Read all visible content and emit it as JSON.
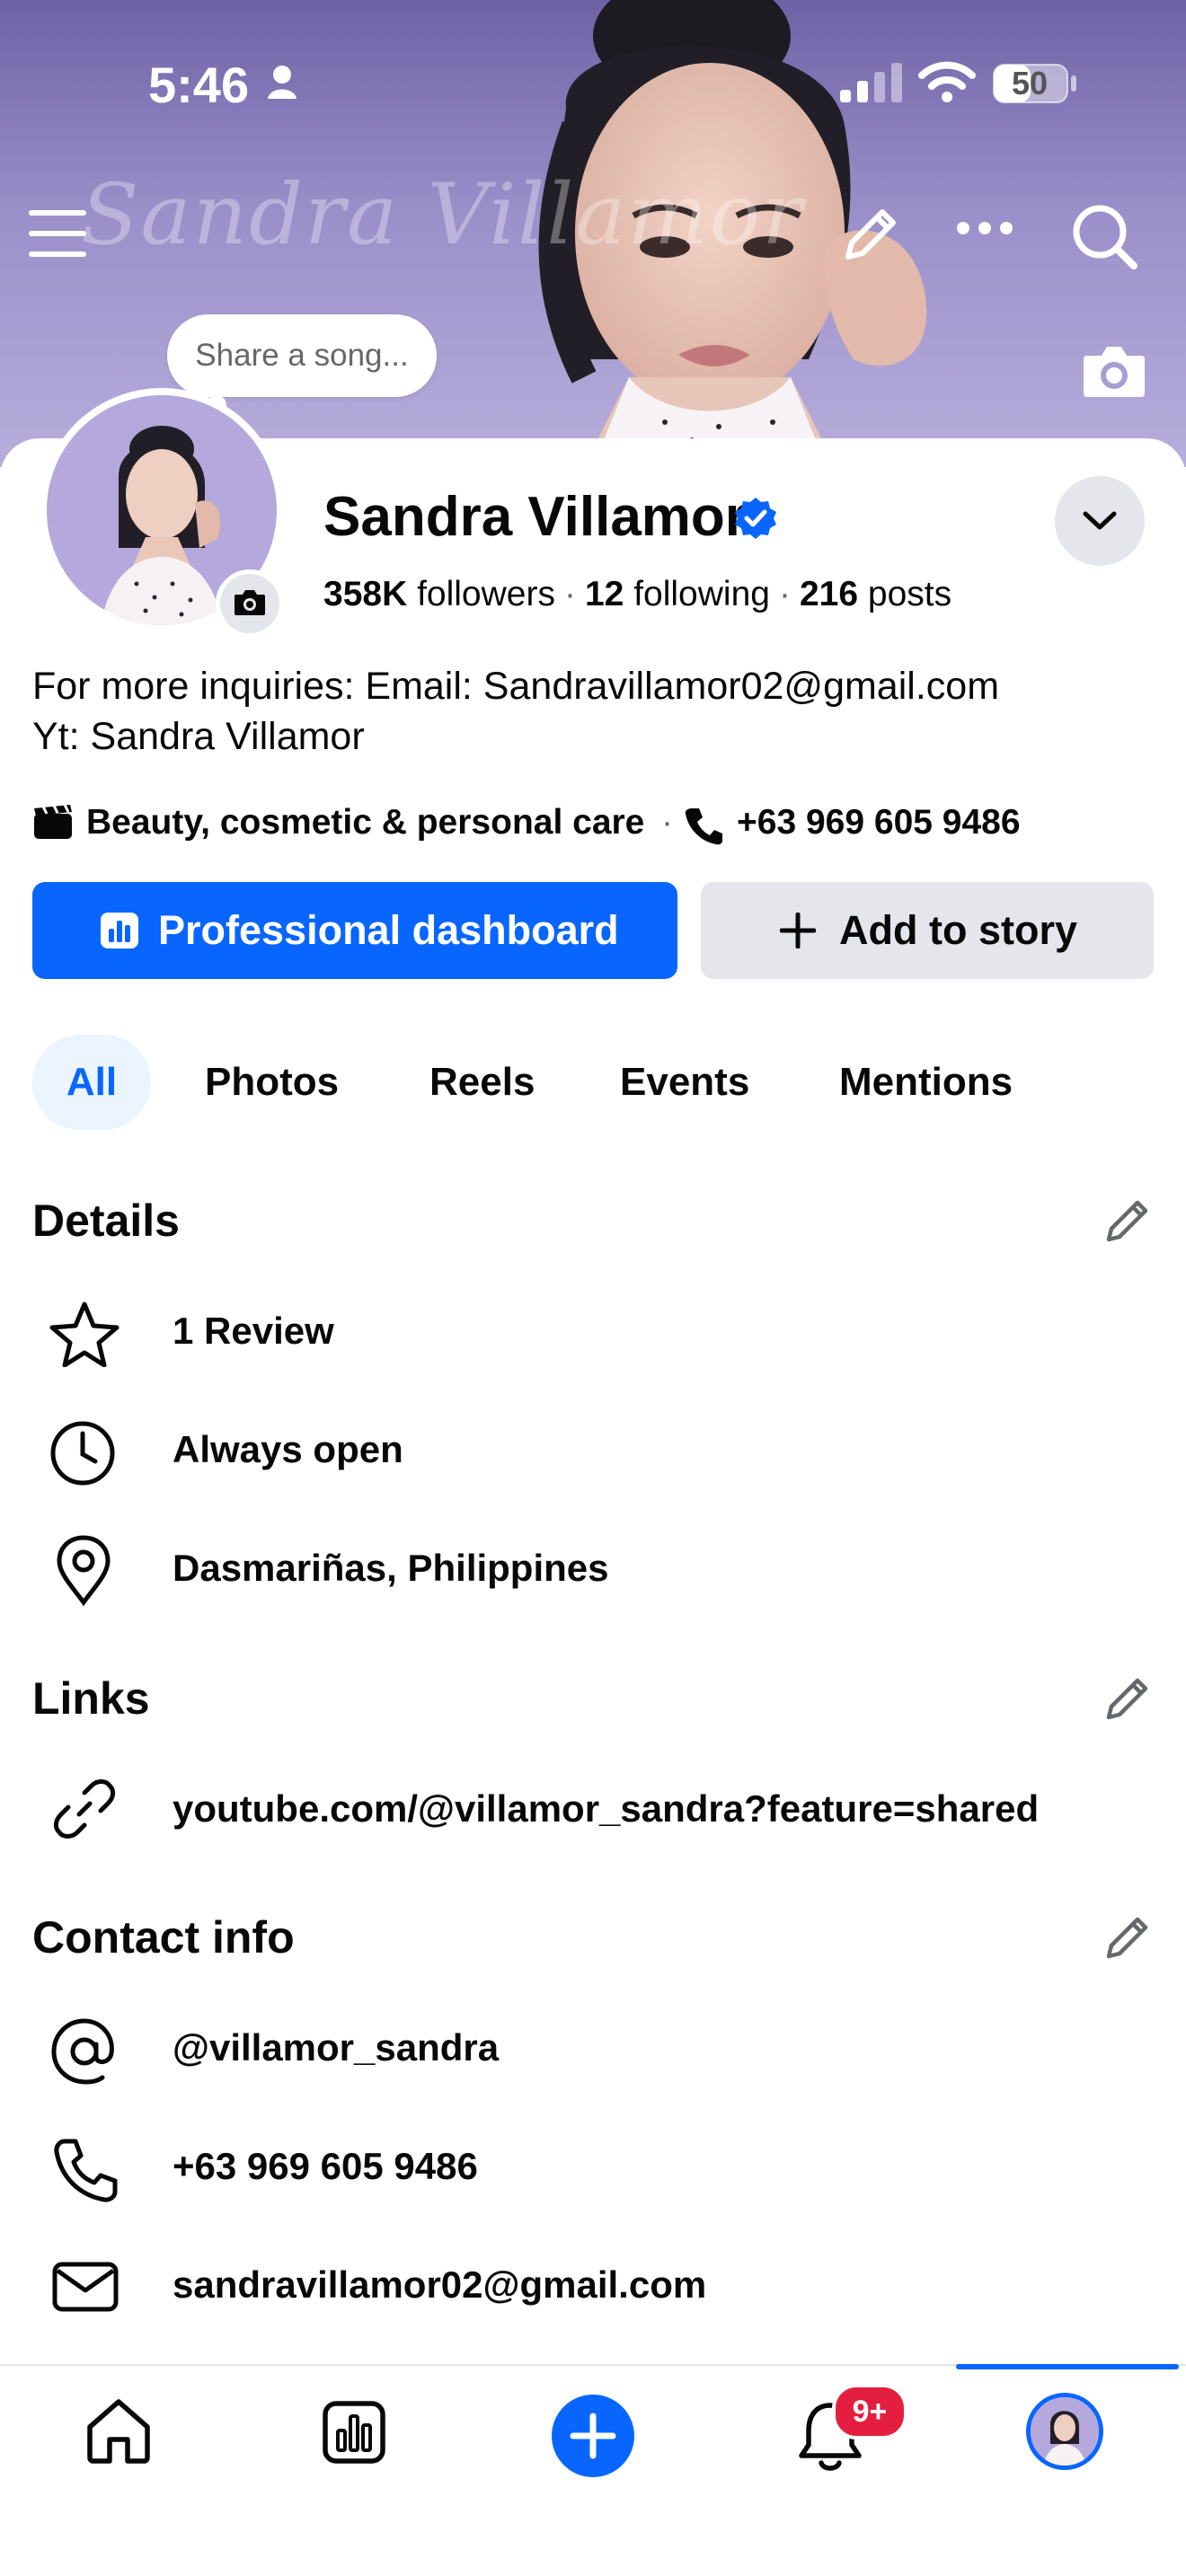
{
  "status_bar": {
    "time": "5:46",
    "battery": "50"
  },
  "cover": {
    "signature_text": "Sandra Villamor",
    "song_prompt": "Share a song..."
  },
  "profile": {
    "name": "Sandra Villamor",
    "verified": true,
    "followers_count": "358K",
    "followers_label": "followers",
    "following_count": "12",
    "following_label": "following",
    "posts_count": "216",
    "posts_label": "posts",
    "bio_line1": "For more inquiries: Email: Sandravillamor02@gmail.com",
    "bio_line2": "Yt: Sandra Villamor",
    "category": "Beauty, cosmetic & personal care",
    "category_separator": "·",
    "phone": "+63 969 605 9486"
  },
  "actions": {
    "dashboard_label": "Professional dashboard",
    "story_label": "Add to story"
  },
  "tabs": [
    {
      "label": "All",
      "active": true
    },
    {
      "label": "Photos",
      "active": false
    },
    {
      "label": "Reels",
      "active": false
    },
    {
      "label": "Events",
      "active": false
    },
    {
      "label": "Mentions",
      "active": false
    }
  ],
  "details": {
    "title": "Details",
    "items": [
      {
        "icon": "star-icon",
        "text": "1 Review"
      },
      {
        "icon": "clock-icon",
        "text": "Always open"
      },
      {
        "icon": "location-pin-icon",
        "text": "Dasmariñas, Philippines"
      }
    ]
  },
  "links": {
    "title": "Links",
    "items": [
      {
        "icon": "link-icon",
        "text": "youtube.com/@villamor_sandra?feature=shared"
      }
    ]
  },
  "contact": {
    "title": "Contact info",
    "items": [
      {
        "icon": "at-icon",
        "text": "@villamor_sandra"
      },
      {
        "icon": "phone-icon",
        "text": "+63 969 605 9486"
      },
      {
        "icon": "envelope-icon",
        "text": "sandravillamor02@gmail.com"
      }
    ]
  },
  "bottom_nav": {
    "items": [
      "home-icon",
      "dashboard-icon",
      "create-icon",
      "notifications-icon",
      "profile-icon"
    ],
    "notification_badge": "9+",
    "active": "profile-icon"
  },
  "colors": {
    "accent": "#0866ff",
    "badge": "#e41e3f",
    "secondary_button": "#e4e6eb",
    "active_tab_bg": "#ebf5ff",
    "cover_bg": "#9a8fc9"
  }
}
